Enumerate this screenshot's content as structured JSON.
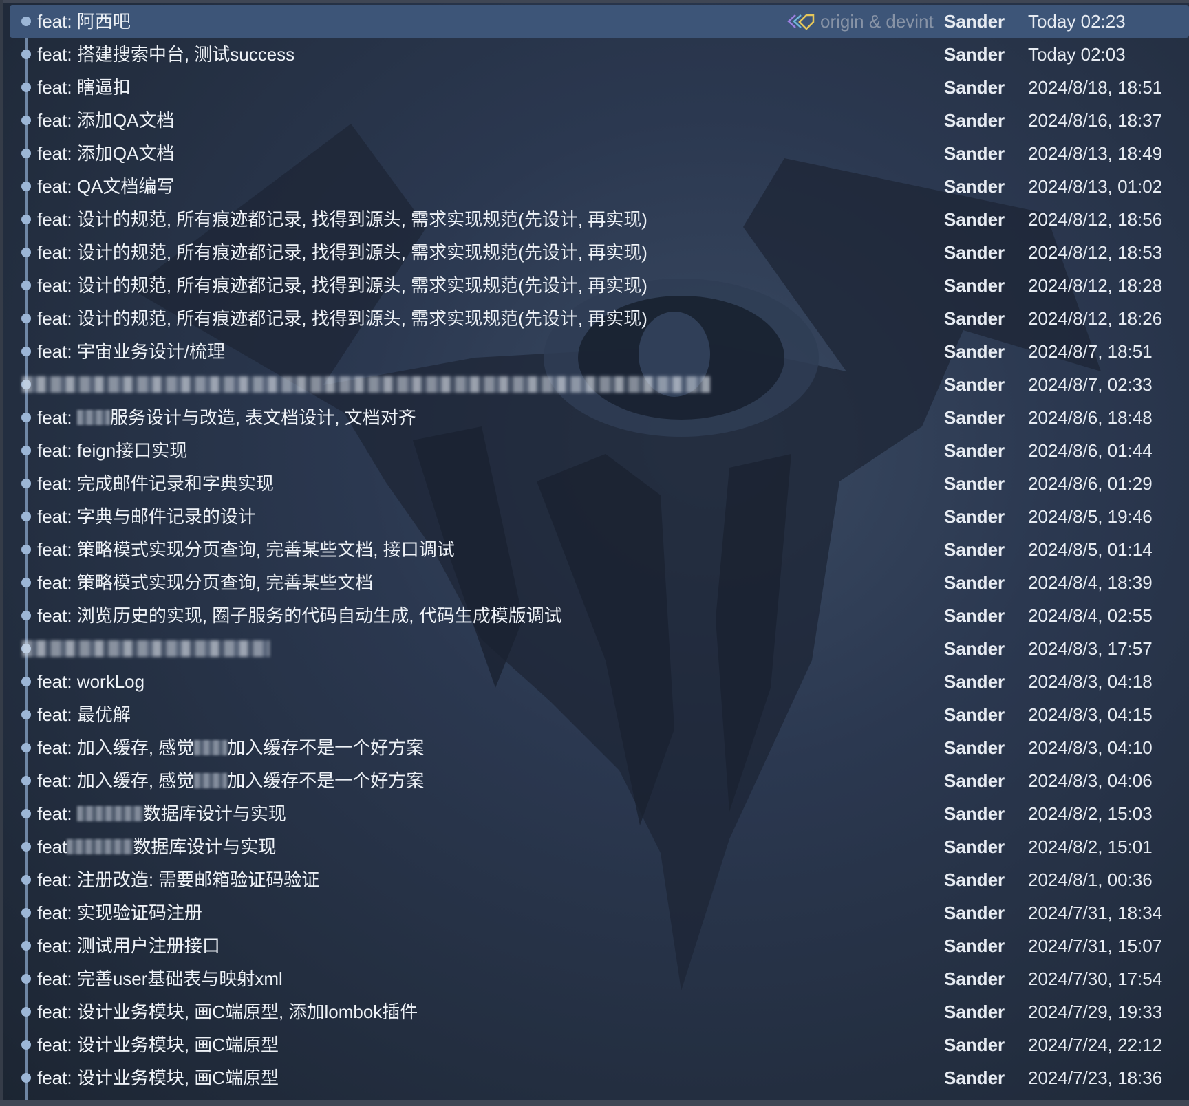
{
  "selected_refs": {
    "text": "origin & devint",
    "icon": "tag-icon"
  },
  "colors": {
    "selected_row": "#3d5578",
    "graph_line": "#8aa6c8",
    "background": "#263248",
    "refs_text": "#8793a6"
  },
  "commits": [
    {
      "message": "feat: 阿西吧",
      "author": "Sander",
      "date": "Today 02:23",
      "selected": true
    },
    {
      "message": "feat: 搭建搜索中台, 测试success",
      "author": "Sander",
      "date": "Today 02:03"
    },
    {
      "message": "feat: 瞎逼扣",
      "author": "Sander",
      "date": "2024/8/18, 18:51"
    },
    {
      "message": "feat: 添加QA文档",
      "author": "Sander",
      "date": "2024/8/16, 18:37"
    },
    {
      "message": "feat: 添加QA文档",
      "author": "Sander",
      "date": "2024/8/13, 18:49"
    },
    {
      "message": "feat: QA文档编写",
      "author": "Sander",
      "date": "2024/8/13, 01:02"
    },
    {
      "message": "feat: 设计的规范, 所有痕迹都记录, 找得到源头, 需求实现规范(先设计, 再实现)",
      "author": "Sander",
      "date": "2024/8/12, 18:56"
    },
    {
      "message": "feat: 设计的规范, 所有痕迹都记录, 找得到源头, 需求实现规范(先设计, 再实现)",
      "author": "Sander",
      "date": "2024/8/12, 18:53"
    },
    {
      "message": "feat: 设计的规范, 所有痕迹都记录, 找得到源头, 需求实现规范(先设计, 再实现)",
      "author": "Sander",
      "date": "2024/8/12, 18:28"
    },
    {
      "message": "feat: 设计的规范, 所有痕迹都记录, 找得到源头, 需求实现规范(先设计, 再实现)",
      "author": "Sander",
      "date": "2024/8/12, 18:26"
    },
    {
      "message": "feat: 宇宙业务设计/梳理",
      "author": "Sander",
      "date": "2024/8/7, 18:51"
    },
    {
      "message": "",
      "author": "Sander",
      "date": "2024/8/7, 02:33",
      "redacted": "long"
    },
    {
      "message_prefix": "feat: ",
      "message_suffix": "服务设计与改造, 表文档设计, 文档对齐",
      "author": "Sander",
      "date": "2024/8/6, 18:48",
      "mask": "short"
    },
    {
      "message": "feat: feign接口实现",
      "author": "Sander",
      "date": "2024/8/6, 01:44"
    },
    {
      "message": "feat: 完成邮件记录和字典实现",
      "author": "Sander",
      "date": "2024/8/6, 01:29"
    },
    {
      "message": "feat: 字典与邮件记录的设计",
      "author": "Sander",
      "date": "2024/8/5, 19:46"
    },
    {
      "message": "feat: 策略模式实现分页查询, 完善某些文档, 接口调试",
      "author": "Sander",
      "date": "2024/8/5, 01:14"
    },
    {
      "message": "feat: 策略模式实现分页查询, 完善某些文档",
      "author": "Sander",
      "date": "2024/8/4, 18:39"
    },
    {
      "message": "feat: 浏览历史的实现, 圈子服务的代码自动生成, 代码生成模版调试",
      "author": "Sander",
      "date": "2024/8/4, 02:55"
    },
    {
      "message": "",
      "author": "Sander",
      "date": "2024/8/3, 17:57",
      "redacted": "short"
    },
    {
      "message": "feat: workLog",
      "author": "Sander",
      "date": "2024/8/3, 04:18"
    },
    {
      "message": "feat: 最优解",
      "author": "Sander",
      "date": "2024/8/3, 04:15"
    },
    {
      "message_prefix": "feat: 加入缓存, 感觉",
      "message_suffix": "加入缓存不是一个好方案",
      "author": "Sander",
      "date": "2024/8/3, 04:10",
      "mask": "short"
    },
    {
      "message_prefix": "feat: 加入缓存, 感觉",
      "message_suffix": "加入缓存不是一个好方案",
      "author": "Sander",
      "date": "2024/8/3, 04:06",
      "mask": "short"
    },
    {
      "message_prefix": "feat: ",
      "message_suffix": "数据库设计与实现",
      "author": "Sander",
      "date": "2024/8/2, 15:03",
      "mask": "long"
    },
    {
      "message_prefix": "feat",
      "message_suffix": "数据库设计与实现",
      "author": "Sander",
      "date": "2024/8/2, 15:01",
      "mask": "long"
    },
    {
      "message": "feat: 注册改造: 需要邮箱验证码验证",
      "author": "Sander",
      "date": "2024/8/1, 00:36"
    },
    {
      "message": "feat: 实现验证码注册",
      "author": "Sander",
      "date": "2024/7/31, 18:34"
    },
    {
      "message": "feat: 测试用户注册接口",
      "author": "Sander",
      "date": "2024/7/31, 15:07"
    },
    {
      "message": "feat: 完善user基础表与映射xml",
      "author": "Sander",
      "date": "2024/7/30, 17:54"
    },
    {
      "message": "feat: 设计业务模块, 画C端原型, 添加lombok插件",
      "author": "Sander",
      "date": "2024/7/29, 19:33"
    },
    {
      "message": "feat: 设计业务模块, 画C端原型",
      "author": "Sander",
      "date": "2024/7/24, 22:12"
    },
    {
      "message": "feat: 设计业务模块, 画C端原型",
      "author": "Sander",
      "date": "2024/7/23, 18:36"
    }
  ]
}
